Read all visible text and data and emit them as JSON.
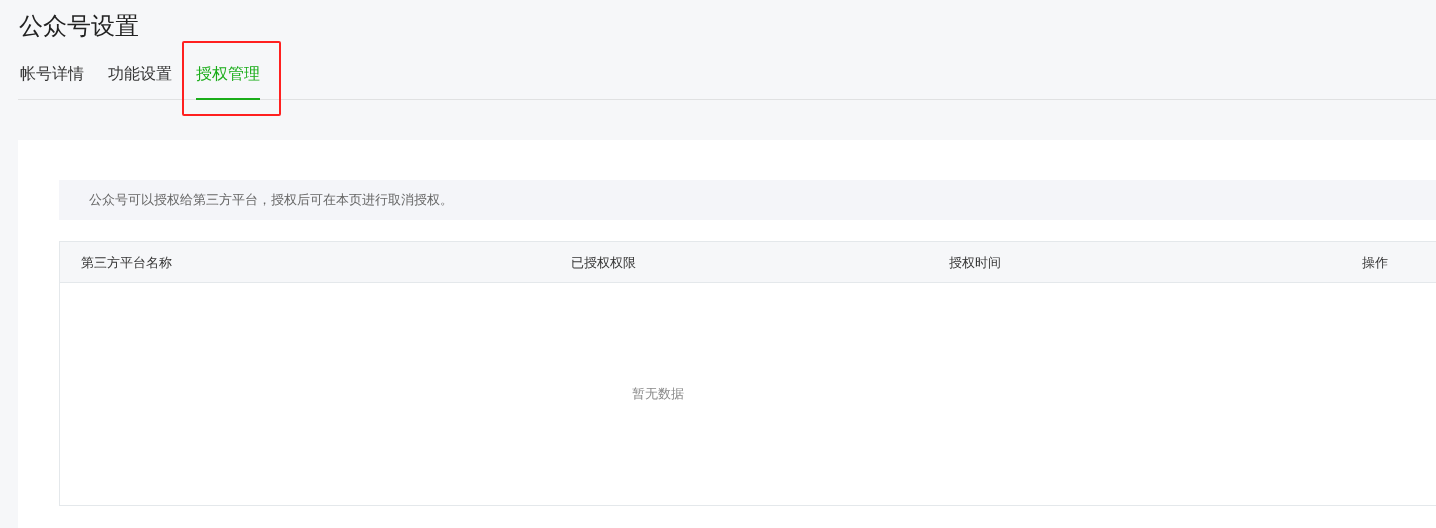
{
  "page": {
    "title": "公众号设置"
  },
  "tabs": [
    {
      "label": "帐号详情",
      "selected": false,
      "highlighted": false
    },
    {
      "label": "功能设置",
      "selected": false,
      "highlighted": false
    },
    {
      "label": "授权管理",
      "selected": true,
      "highlighted": true
    }
  ],
  "notice": "公众号可以授权给第三方平台，授权后可在本页进行取消授权。",
  "table": {
    "columns": [
      "第三方平台名称",
      "已授权权限",
      "授权时间",
      "操作"
    ],
    "empty_text": "暂无数据"
  }
}
